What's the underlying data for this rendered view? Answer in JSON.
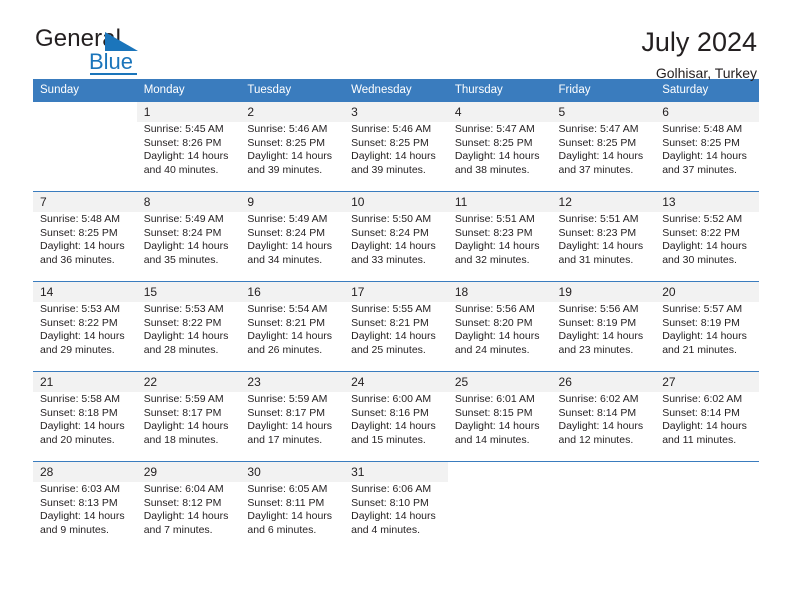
{
  "logo": {
    "text_primary": "General",
    "text_secondary": "Blue",
    "icon": "triangle-flag-icon",
    "brand_color": "#1b75bb"
  },
  "header": {
    "title": "July 2024",
    "subtitle": "Golhisar, Turkey"
  },
  "calendar": {
    "header_bg": "#3a7cbe",
    "header_text_color": "#ffffff",
    "row_shade": "#f2f2f2",
    "weekdays": [
      "Sunday",
      "Monday",
      "Tuesday",
      "Wednesday",
      "Thursday",
      "Friday",
      "Saturday"
    ],
    "weeks": [
      [
        {
          "day": "",
          "lines": []
        },
        {
          "day": "1",
          "lines": [
            "Sunrise: 5:45 AM",
            "Sunset: 8:26 PM",
            "Daylight: 14 hours",
            "and 40 minutes."
          ]
        },
        {
          "day": "2",
          "lines": [
            "Sunrise: 5:46 AM",
            "Sunset: 8:25 PM",
            "Daylight: 14 hours",
            "and 39 minutes."
          ]
        },
        {
          "day": "3",
          "lines": [
            "Sunrise: 5:46 AM",
            "Sunset: 8:25 PM",
            "Daylight: 14 hours",
            "and 39 minutes."
          ]
        },
        {
          "day": "4",
          "lines": [
            "Sunrise: 5:47 AM",
            "Sunset: 8:25 PM",
            "Daylight: 14 hours",
            "and 38 minutes."
          ]
        },
        {
          "day": "5",
          "lines": [
            "Sunrise: 5:47 AM",
            "Sunset: 8:25 PM",
            "Daylight: 14 hours",
            "and 37 minutes."
          ]
        },
        {
          "day": "6",
          "lines": [
            "Sunrise: 5:48 AM",
            "Sunset: 8:25 PM",
            "Daylight: 14 hours",
            "and 37 minutes."
          ]
        }
      ],
      [
        {
          "day": "7",
          "lines": [
            "Sunrise: 5:48 AM",
            "Sunset: 8:25 PM",
            "Daylight: 14 hours",
            "and 36 minutes."
          ]
        },
        {
          "day": "8",
          "lines": [
            "Sunrise: 5:49 AM",
            "Sunset: 8:24 PM",
            "Daylight: 14 hours",
            "and 35 minutes."
          ]
        },
        {
          "day": "9",
          "lines": [
            "Sunrise: 5:49 AM",
            "Sunset: 8:24 PM",
            "Daylight: 14 hours",
            "and 34 minutes."
          ]
        },
        {
          "day": "10",
          "lines": [
            "Sunrise: 5:50 AM",
            "Sunset: 8:24 PM",
            "Daylight: 14 hours",
            "and 33 minutes."
          ]
        },
        {
          "day": "11",
          "lines": [
            "Sunrise: 5:51 AM",
            "Sunset: 8:23 PM",
            "Daylight: 14 hours",
            "and 32 minutes."
          ]
        },
        {
          "day": "12",
          "lines": [
            "Sunrise: 5:51 AM",
            "Sunset: 8:23 PM",
            "Daylight: 14 hours",
            "and 31 minutes."
          ]
        },
        {
          "day": "13",
          "lines": [
            "Sunrise: 5:52 AM",
            "Sunset: 8:22 PM",
            "Daylight: 14 hours",
            "and 30 minutes."
          ]
        }
      ],
      [
        {
          "day": "14",
          "lines": [
            "Sunrise: 5:53 AM",
            "Sunset: 8:22 PM",
            "Daylight: 14 hours",
            "and 29 minutes."
          ]
        },
        {
          "day": "15",
          "lines": [
            "Sunrise: 5:53 AM",
            "Sunset: 8:22 PM",
            "Daylight: 14 hours",
            "and 28 minutes."
          ]
        },
        {
          "day": "16",
          "lines": [
            "Sunrise: 5:54 AM",
            "Sunset: 8:21 PM",
            "Daylight: 14 hours",
            "and 26 minutes."
          ]
        },
        {
          "day": "17",
          "lines": [
            "Sunrise: 5:55 AM",
            "Sunset: 8:21 PM",
            "Daylight: 14 hours",
            "and 25 minutes."
          ]
        },
        {
          "day": "18",
          "lines": [
            "Sunrise: 5:56 AM",
            "Sunset: 8:20 PM",
            "Daylight: 14 hours",
            "and 24 minutes."
          ]
        },
        {
          "day": "19",
          "lines": [
            "Sunrise: 5:56 AM",
            "Sunset: 8:19 PM",
            "Daylight: 14 hours",
            "and 23 minutes."
          ]
        },
        {
          "day": "20",
          "lines": [
            "Sunrise: 5:57 AM",
            "Sunset: 8:19 PM",
            "Daylight: 14 hours",
            "and 21 minutes."
          ]
        }
      ],
      [
        {
          "day": "21",
          "lines": [
            "Sunrise: 5:58 AM",
            "Sunset: 8:18 PM",
            "Daylight: 14 hours",
            "and 20 minutes."
          ]
        },
        {
          "day": "22",
          "lines": [
            "Sunrise: 5:59 AM",
            "Sunset: 8:17 PM",
            "Daylight: 14 hours",
            "and 18 minutes."
          ]
        },
        {
          "day": "23",
          "lines": [
            "Sunrise: 5:59 AM",
            "Sunset: 8:17 PM",
            "Daylight: 14 hours",
            "and 17 minutes."
          ]
        },
        {
          "day": "24",
          "lines": [
            "Sunrise: 6:00 AM",
            "Sunset: 8:16 PM",
            "Daylight: 14 hours",
            "and 15 minutes."
          ]
        },
        {
          "day": "25",
          "lines": [
            "Sunrise: 6:01 AM",
            "Sunset: 8:15 PM",
            "Daylight: 14 hours",
            "and 14 minutes."
          ]
        },
        {
          "day": "26",
          "lines": [
            "Sunrise: 6:02 AM",
            "Sunset: 8:14 PM",
            "Daylight: 14 hours",
            "and 12 minutes."
          ]
        },
        {
          "day": "27",
          "lines": [
            "Sunrise: 6:02 AM",
            "Sunset: 8:14 PM",
            "Daylight: 14 hours",
            "and 11 minutes."
          ]
        }
      ],
      [
        {
          "day": "28",
          "lines": [
            "Sunrise: 6:03 AM",
            "Sunset: 8:13 PM",
            "Daylight: 14 hours",
            "and 9 minutes."
          ]
        },
        {
          "day": "29",
          "lines": [
            "Sunrise: 6:04 AM",
            "Sunset: 8:12 PM",
            "Daylight: 14 hours",
            "and 7 minutes."
          ]
        },
        {
          "day": "30",
          "lines": [
            "Sunrise: 6:05 AM",
            "Sunset: 8:11 PM",
            "Daylight: 14 hours",
            "and 6 minutes."
          ]
        },
        {
          "day": "31",
          "lines": [
            "Sunrise: 6:06 AM",
            "Sunset: 8:10 PM",
            "Daylight: 14 hours",
            "and 4 minutes."
          ]
        },
        {
          "day": "",
          "lines": []
        },
        {
          "day": "",
          "lines": []
        },
        {
          "day": "",
          "lines": []
        }
      ]
    ]
  }
}
